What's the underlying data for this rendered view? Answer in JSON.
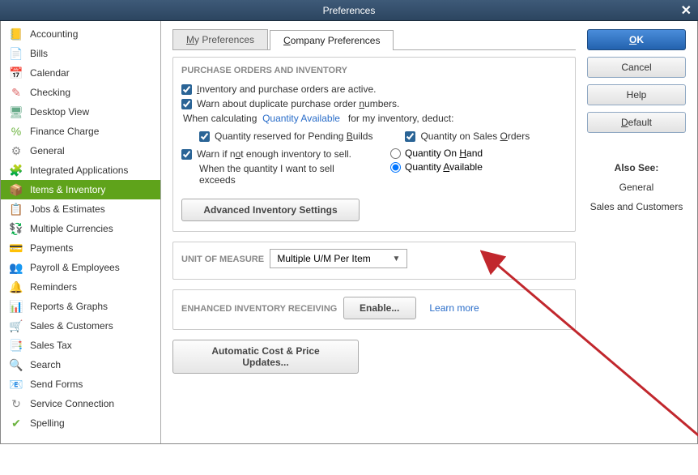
{
  "window": {
    "title": "Preferences"
  },
  "sidebar": {
    "items": [
      {
        "label": "Accounting",
        "icon": "📒",
        "color": "#e09a3e"
      },
      {
        "label": "Bills",
        "icon": "📄",
        "color": "#5da9d6"
      },
      {
        "label": "Calendar",
        "icon": "📅",
        "color": "#5a7fa6"
      },
      {
        "label": "Checking",
        "icon": "✎",
        "color": "#d66"
      },
      {
        "label": "Desktop View",
        "icon": "🖥",
        "color": "#6a8"
      },
      {
        "label": "Finance Charge",
        "icon": "%",
        "color": "#6cb33f"
      },
      {
        "label": "General",
        "icon": "⚙",
        "color": "#888"
      },
      {
        "label": "Integrated Applications",
        "icon": "🧩",
        "color": "#6cb33f"
      },
      {
        "label": "Items & Inventory",
        "icon": "📦",
        "color": "#e09a3e",
        "selected": true
      },
      {
        "label": "Jobs & Estimates",
        "icon": "📋",
        "color": "#e09a3e"
      },
      {
        "label": "Multiple Currencies",
        "icon": "💱",
        "color": "#6cb33f"
      },
      {
        "label": "Payments",
        "icon": "💳",
        "color": "#6cb33f"
      },
      {
        "label": "Payroll & Employees",
        "icon": "👥",
        "color": "#5a8"
      },
      {
        "label": "Reminders",
        "icon": "🔔",
        "color": "#e09a3e"
      },
      {
        "label": "Reports & Graphs",
        "icon": "📊",
        "color": "#6cb33f"
      },
      {
        "label": "Sales & Customers",
        "icon": "🛒",
        "color": "#d66"
      },
      {
        "label": "Sales Tax",
        "icon": "📑",
        "color": "#e09a3e"
      },
      {
        "label": "Search",
        "icon": "🔍",
        "color": "#888"
      },
      {
        "label": "Send Forms",
        "icon": "📧",
        "color": "#5da9d6"
      },
      {
        "label": "Service Connection",
        "icon": "↻",
        "color": "#888"
      },
      {
        "label": "Spelling",
        "icon": "✔",
        "color": "#6cb33f"
      }
    ]
  },
  "tabs": {
    "my_prefs": "My Preferences",
    "company_prefs": "Company Preferences"
  },
  "purchase_orders": {
    "title": "PURCHASE ORDERS AND INVENTORY",
    "inv_active": "Inventory and purchase orders are active.",
    "warn_dup_po": "Warn about duplicate purchase order numbers.",
    "when_calc_pre": "When calculating",
    "qty_available_link": "Quantity Available",
    "when_calc_post": "for my inventory, deduct:",
    "qty_reserved": "Quantity reserved for Pending Builds",
    "qty_sales_orders": "Quantity on Sales Orders",
    "warn_not_enough": "Warn if not enough inventory to sell.",
    "when_qty_exceeds": "When the quantity I want to sell exceeds",
    "radio_on_hand": "Quantity On Hand",
    "radio_available": "Quantity Available",
    "adv_btn": "Advanced Inventory Settings"
  },
  "uom": {
    "title": "UNIT OF MEASURE",
    "selected": "Multiple U/M Per Item"
  },
  "eir": {
    "title": "ENHANCED INVENTORY RECEIVING",
    "enable_btn": "Enable...",
    "learn_more": "Learn more"
  },
  "auto_cost": {
    "btn": "Automatic Cost & Price Updates..."
  },
  "right": {
    "ok": "OK",
    "cancel": "Cancel",
    "help": "Help",
    "default": "Default",
    "also_see_title": "Also See:",
    "general_link": "General",
    "sales_link": "Sales and Customers"
  }
}
